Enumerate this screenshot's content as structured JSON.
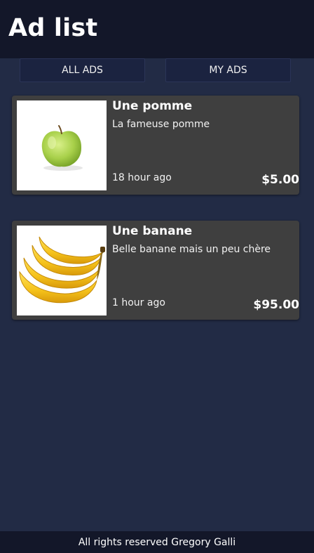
{
  "header": {
    "title": "Ad list"
  },
  "tabs": {
    "all_label": "ALL ADS",
    "my_label": "MY ADS"
  },
  "ads": [
    {
      "title": "Une pomme",
      "description": "La fameuse pomme",
      "time": "18 hour ago",
      "price": "$5.00",
      "image_icon": "green-apple-icon"
    },
    {
      "title": "Une banane",
      "description": "Belle banane mais un peu chère",
      "time": "1 hour ago",
      "price": "$95.00",
      "image_icon": "banana-bunch-icon"
    }
  ],
  "footer": {
    "text": "All rights reserved Gregory Galli"
  },
  "colors": {
    "background": "#222b45",
    "header": "#131729",
    "card": "#3f3f3f",
    "tab": "#1b2340"
  }
}
